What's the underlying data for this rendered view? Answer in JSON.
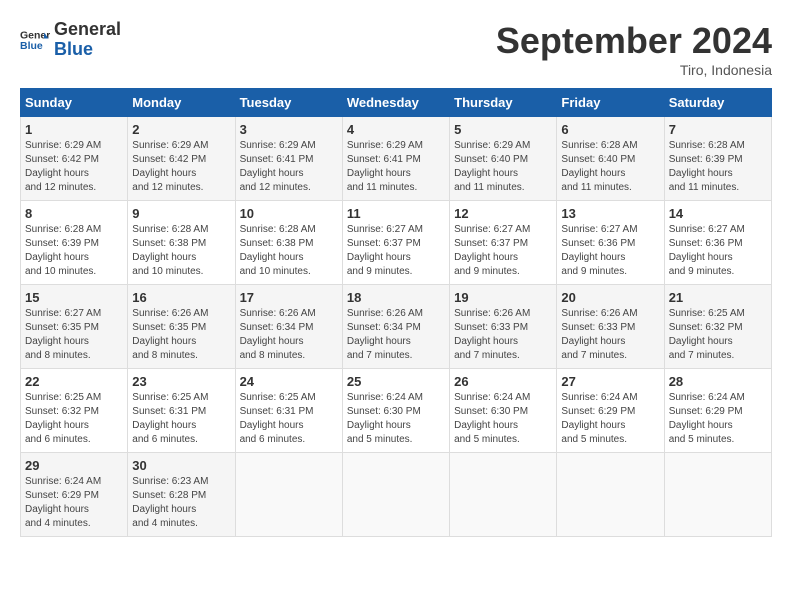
{
  "header": {
    "logo_general": "General",
    "logo_blue": "Blue",
    "month_title": "September 2024",
    "location": "Tiro, Indonesia"
  },
  "weekdays": [
    "Sunday",
    "Monday",
    "Tuesday",
    "Wednesday",
    "Thursday",
    "Friday",
    "Saturday"
  ],
  "weeks": [
    [
      {
        "day": "1",
        "sunrise": "6:29 AM",
        "sunset": "6:42 PM",
        "daylight": "12 hours and 12 minutes."
      },
      {
        "day": "2",
        "sunrise": "6:29 AM",
        "sunset": "6:42 PM",
        "daylight": "12 hours and 12 minutes."
      },
      {
        "day": "3",
        "sunrise": "6:29 AM",
        "sunset": "6:41 PM",
        "daylight": "12 hours and 12 minutes."
      },
      {
        "day": "4",
        "sunrise": "6:29 AM",
        "sunset": "6:41 PM",
        "daylight": "12 hours and 11 minutes."
      },
      {
        "day": "5",
        "sunrise": "6:29 AM",
        "sunset": "6:40 PM",
        "daylight": "12 hours and 11 minutes."
      },
      {
        "day": "6",
        "sunrise": "6:28 AM",
        "sunset": "6:40 PM",
        "daylight": "12 hours and 11 minutes."
      },
      {
        "day": "7",
        "sunrise": "6:28 AM",
        "sunset": "6:39 PM",
        "daylight": "12 hours and 11 minutes."
      }
    ],
    [
      {
        "day": "8",
        "sunrise": "6:28 AM",
        "sunset": "6:39 PM",
        "daylight": "12 hours and 10 minutes."
      },
      {
        "day": "9",
        "sunrise": "6:28 AM",
        "sunset": "6:38 PM",
        "daylight": "12 hours and 10 minutes."
      },
      {
        "day": "10",
        "sunrise": "6:28 AM",
        "sunset": "6:38 PM",
        "daylight": "12 hours and 10 minutes."
      },
      {
        "day": "11",
        "sunrise": "6:27 AM",
        "sunset": "6:37 PM",
        "daylight": "12 hours and 9 minutes."
      },
      {
        "day": "12",
        "sunrise": "6:27 AM",
        "sunset": "6:37 PM",
        "daylight": "12 hours and 9 minutes."
      },
      {
        "day": "13",
        "sunrise": "6:27 AM",
        "sunset": "6:36 PM",
        "daylight": "12 hours and 9 minutes."
      },
      {
        "day": "14",
        "sunrise": "6:27 AM",
        "sunset": "6:36 PM",
        "daylight": "12 hours and 9 minutes."
      }
    ],
    [
      {
        "day": "15",
        "sunrise": "6:27 AM",
        "sunset": "6:35 PM",
        "daylight": "12 hours and 8 minutes."
      },
      {
        "day": "16",
        "sunrise": "6:26 AM",
        "sunset": "6:35 PM",
        "daylight": "12 hours and 8 minutes."
      },
      {
        "day": "17",
        "sunrise": "6:26 AM",
        "sunset": "6:34 PM",
        "daylight": "12 hours and 8 minutes."
      },
      {
        "day": "18",
        "sunrise": "6:26 AM",
        "sunset": "6:34 PM",
        "daylight": "12 hours and 7 minutes."
      },
      {
        "day": "19",
        "sunrise": "6:26 AM",
        "sunset": "6:33 PM",
        "daylight": "12 hours and 7 minutes."
      },
      {
        "day": "20",
        "sunrise": "6:26 AM",
        "sunset": "6:33 PM",
        "daylight": "12 hours and 7 minutes."
      },
      {
        "day": "21",
        "sunrise": "6:25 AM",
        "sunset": "6:32 PM",
        "daylight": "12 hours and 7 minutes."
      }
    ],
    [
      {
        "day": "22",
        "sunrise": "6:25 AM",
        "sunset": "6:32 PM",
        "daylight": "12 hours and 6 minutes."
      },
      {
        "day": "23",
        "sunrise": "6:25 AM",
        "sunset": "6:31 PM",
        "daylight": "12 hours and 6 minutes."
      },
      {
        "day": "24",
        "sunrise": "6:25 AM",
        "sunset": "6:31 PM",
        "daylight": "12 hours and 6 minutes."
      },
      {
        "day": "25",
        "sunrise": "6:24 AM",
        "sunset": "6:30 PM",
        "daylight": "12 hours and 5 minutes."
      },
      {
        "day": "26",
        "sunrise": "6:24 AM",
        "sunset": "6:30 PM",
        "daylight": "12 hours and 5 minutes."
      },
      {
        "day": "27",
        "sunrise": "6:24 AM",
        "sunset": "6:29 PM",
        "daylight": "12 hours and 5 minutes."
      },
      {
        "day": "28",
        "sunrise": "6:24 AM",
        "sunset": "6:29 PM",
        "daylight": "12 hours and 5 minutes."
      }
    ],
    [
      {
        "day": "29",
        "sunrise": "6:24 AM",
        "sunset": "6:29 PM",
        "daylight": "12 hours and 4 minutes."
      },
      {
        "day": "30",
        "sunrise": "6:23 AM",
        "sunset": "6:28 PM",
        "daylight": "12 hours and 4 minutes."
      },
      null,
      null,
      null,
      null,
      null
    ]
  ]
}
